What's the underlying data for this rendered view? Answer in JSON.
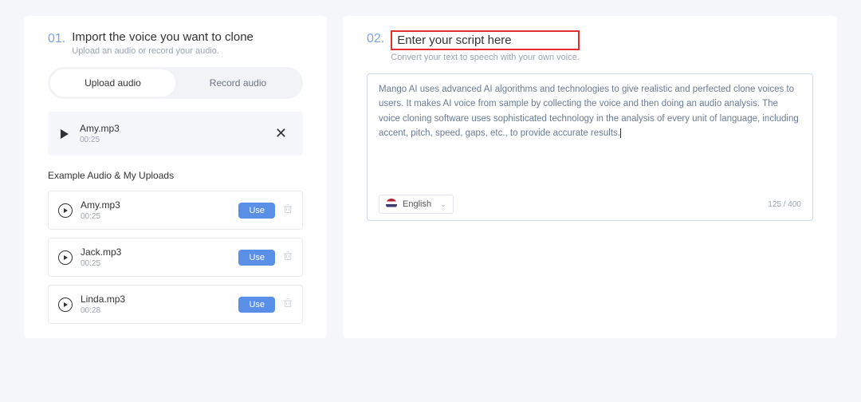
{
  "step1": {
    "num": "01.",
    "title": "Import the voice you want to clone",
    "subtitle": "Upload an audio or record your audio."
  },
  "step2": {
    "num": "02.",
    "title": "Enter your script here",
    "subtitle": "Convert your text to speech with your own voice."
  },
  "tabs": {
    "upload": "Upload audio",
    "record": "Record audio"
  },
  "current_audio": {
    "name": "Amy.mp3",
    "duration": "00:25"
  },
  "uploads_section_label": "Example Audio & My Uploads",
  "audio_list": [
    {
      "name": "Amy.mp3",
      "duration": "00:25"
    },
    {
      "name": "Jack.mp3",
      "duration": "00:25"
    },
    {
      "name": "Linda.mp3",
      "duration": "00:28"
    }
  ],
  "use_label": "Use",
  "script_text": "Mango AI uses advanced AI algorithms and technologies to give realistic and perfected clone voices to users. It makes AI voice from sample by collecting the voice and then doing an audio analysis. The voice cloning software uses sophisticated technology in the analysis of every unit of language, including accent, pitch, speed, gaps, etc., to provide accurate results.",
  "language": {
    "selected": "English"
  },
  "char_count": "125 / 400"
}
